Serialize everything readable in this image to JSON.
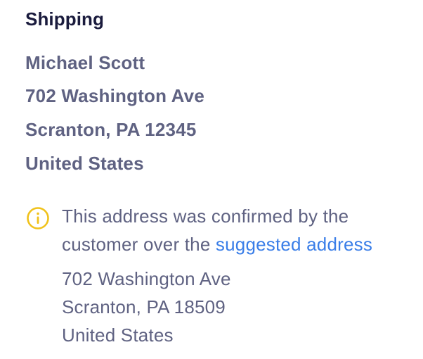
{
  "shipping": {
    "title": "Shipping",
    "address": {
      "name": "Michael Scott",
      "street": "702 Washington Ave",
      "city_state_zip": "Scranton, PA 12345",
      "country": "United States"
    }
  },
  "notice": {
    "icon": "info-icon",
    "icon_color": "#f0c21b",
    "text_line1": "This address was confirmed by the",
    "text_line2_prefix": "customer over the ",
    "link_label": "suggested address",
    "link_color": "#3a7ee8",
    "suggested_address": {
      "street": "702 Washington Ave",
      "city_state_zip": "Scranton, PA 18509",
      "country": "United States"
    }
  }
}
